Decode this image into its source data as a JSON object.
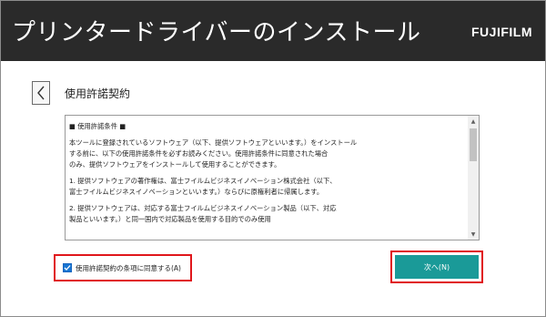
{
  "header": {
    "title": "プリンタードライバーのインストール",
    "brand": "FUJIFILM"
  },
  "page": {
    "title": "使用許諾契約"
  },
  "license": {
    "heading": "■ 使用許諾条件 ■",
    "paragraphs": [
      [
        "本ツールに登録されているソフトウェア（以下、提供ソフトウェアといいます。）をインストール",
        "する前に、以下の使用許諾条件を必ずお読みください。使用許諾条件に同意された場合",
        "のみ、提供ソフトウェアをインストールして使用することができます。"
      ],
      [
        "1. 提供ソフトウェアの著作権は、富士フイルムビジネスイノベーション株式会社（以下、",
        "   富士フイルムビジネスイノベーションといいます。）ならびに原権利者に帰属します。"
      ],
      [
        "2. 提供ソフトウェアは、対応する富士フイルムビジネスイノベーション製品（以下、対応",
        "   製品といいます。）と同一国内で対応製品を使用する目的でのみ使用"
      ]
    ]
  },
  "agree": {
    "label": "使用許諾契約の条項に同意する(A)",
    "checked": true
  },
  "buttons": {
    "next": "次へ(N)"
  },
  "colors": {
    "header_bg": "#2a2a2a",
    "accent": "#1a9a98",
    "highlight": "#e0161b",
    "checkbox": "#1976d2"
  }
}
